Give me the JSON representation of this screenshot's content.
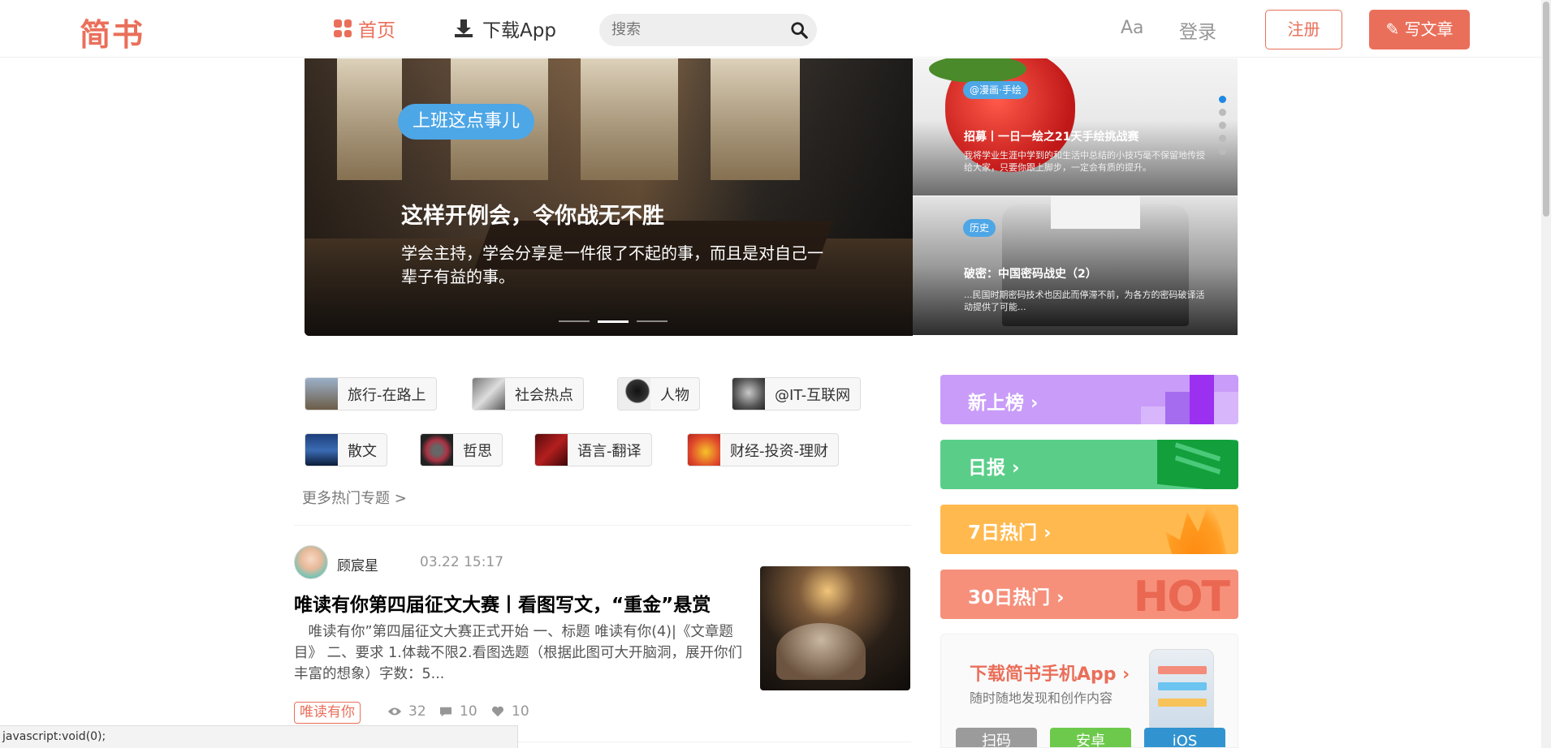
{
  "header": {
    "logo": "简书",
    "nav_home": "首页",
    "nav_download": "下载App",
    "search_placeholder": "搜索",
    "font_toggle": "Aa",
    "login": "登录",
    "register": "注册",
    "write": "写文章"
  },
  "banner": {
    "main_tag": "上班这点事儿",
    "main_title": "这样开例会，令你战无不胜",
    "main_subtitle": "学会主持，学会分享是一件很了不起的事，而且是对自己一辈子有益的事。",
    "side_cards": [
      {
        "tag": "@漫画·手绘",
        "title": "招募丨一日一绘之21天手绘挑战赛",
        "desc": "我将学业生涯中学到的和生活中总结的小技巧毫不保留地传授给大家，只要你跟上脚步，一定会有质的提升。"
      },
      {
        "tag": "历史",
        "title": "破密：中国密码战史（2）",
        "desc": "...民国时期密码技术也因此而停滞不前，为各方的密码破译活动提供了可能..."
      }
    ]
  },
  "topics": [
    {
      "label": "旅行-在路上"
    },
    {
      "label": "社会热点"
    },
    {
      "label": "人物"
    },
    {
      "label": "@IT-互联网"
    },
    {
      "label": "散文"
    },
    {
      "label": "哲思"
    },
    {
      "label": "语言-翻译"
    },
    {
      "label": "财经-投资-理财"
    }
  ],
  "more_topics": "更多热门专题  >",
  "article": {
    "author": "顾宸星",
    "time": "03.22 15:17",
    "title": "唯读有你第四届征文大赛丨看图写文，“重金”悬赏",
    "abstract": "　唯读有你”第四届征文大赛正式开始 一、标题 唯读有你(4)|《文章题目》 二、要求 1.体裁不限2.看图选题（根据此图可大开脑洞，展开你们丰富的想象）字数：5...",
    "collection_tag": "唯读有你",
    "views": "32",
    "comments": "10",
    "likes": "10"
  },
  "status_bar": "javascript:void(0);",
  "boards": [
    {
      "label": "新上榜 ›"
    },
    {
      "label": "日报 ›"
    },
    {
      "label": "7日热门 ›"
    },
    {
      "label": "30日热门 ›"
    }
  ],
  "download_card": {
    "title": "下载简书手机App ›",
    "subtitle": "随时随地发现和创作内容",
    "buttons": [
      "扫码",
      "安卓",
      "iOS"
    ]
  },
  "colors": {
    "brand": "#ea6f5a",
    "board_new": "#c89cf8",
    "board_daily": "#5ace89",
    "board_weekly": "#ffb94e",
    "board_monthly": "#f6907b"
  }
}
